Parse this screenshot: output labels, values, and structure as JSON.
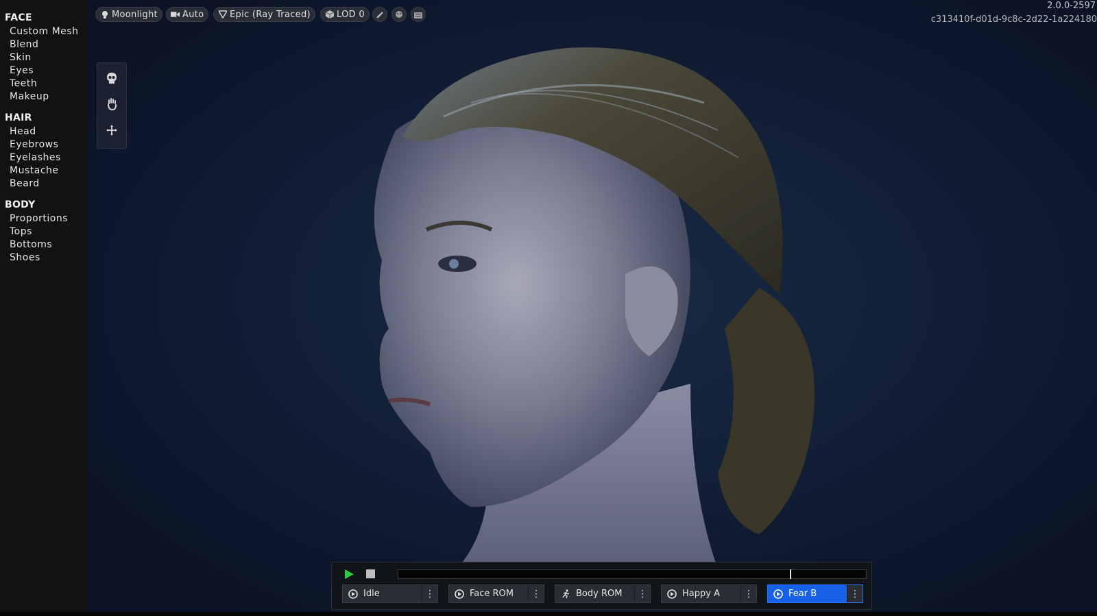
{
  "app": {
    "version": "2.0.0-2597",
    "guid": "c313410f-d01d-9c8c-2d22-1a224180"
  },
  "sidebar": {
    "sections": [
      {
        "title": "FACE",
        "items": [
          "Custom Mesh",
          "Blend",
          "Skin",
          "Eyes",
          "Teeth",
          "Makeup"
        ]
      },
      {
        "title": "HAIR",
        "items": [
          "Head",
          "Eyebrows",
          "Eyelashes",
          "Mustache",
          "Beard"
        ]
      },
      {
        "title": "BODY",
        "items": [
          "Proportions",
          "Tops",
          "Bottoms",
          "Shoes"
        ]
      }
    ]
  },
  "toolbar": {
    "lighting": {
      "label": "Moonlight",
      "icon": "lightbulb-icon"
    },
    "camera": {
      "label": "Auto",
      "icon": "camera-icon"
    },
    "quality": {
      "label": "Epic (Ray Traced)",
      "icon": "quality-icon"
    },
    "lod": {
      "label": "LOD 0",
      "icon": "cube-icon"
    },
    "extra_buttons": [
      "brush-icon",
      "face-mask-icon",
      "keyboard-icon"
    ]
  },
  "tool_palette": [
    "skull-icon",
    "hand-icon",
    "move-icon"
  ],
  "timeline": {
    "playhead_fraction": 0.84,
    "animations": [
      {
        "label": "Idle",
        "icon": "play-circle-icon",
        "active": false
      },
      {
        "label": "Face ROM",
        "icon": "play-circle-icon",
        "active": false
      },
      {
        "label": "Body ROM",
        "icon": "running-figure-icon",
        "active": false
      },
      {
        "label": "Happy A",
        "icon": "play-circle-icon",
        "active": false
      },
      {
        "label": "Fear B",
        "icon": "play-circle-icon",
        "active": true
      }
    ]
  },
  "colors": {
    "accent": "#1760e8",
    "play": "#2ecc40",
    "sidebar_bg": "#121212",
    "viewport_bg": "#13213a"
  }
}
